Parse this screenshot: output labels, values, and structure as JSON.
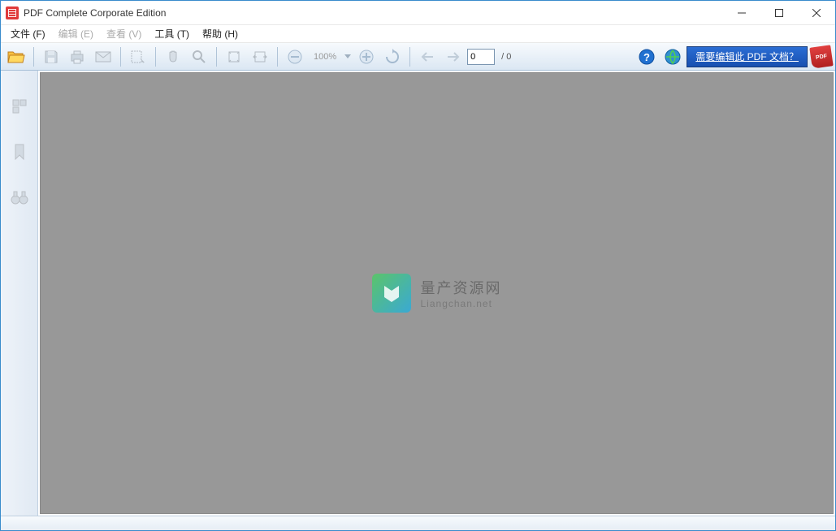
{
  "window": {
    "title": "PDF Complete Corporate Edition"
  },
  "menu": {
    "file": "文件 (F)",
    "edit": "编辑 (E)",
    "view": "查看 (V)",
    "tools": "工具 (T)",
    "help": "帮助 (H)"
  },
  "toolbar": {
    "zoom_level": "100%",
    "page_current": "0",
    "page_total": "/ 0",
    "banner_text": "需要编辑此 PDF 文档？",
    "pdf_badge": "PDF"
  },
  "watermark": {
    "title": "量产资源网",
    "subtitle": "Liangchan.net"
  }
}
